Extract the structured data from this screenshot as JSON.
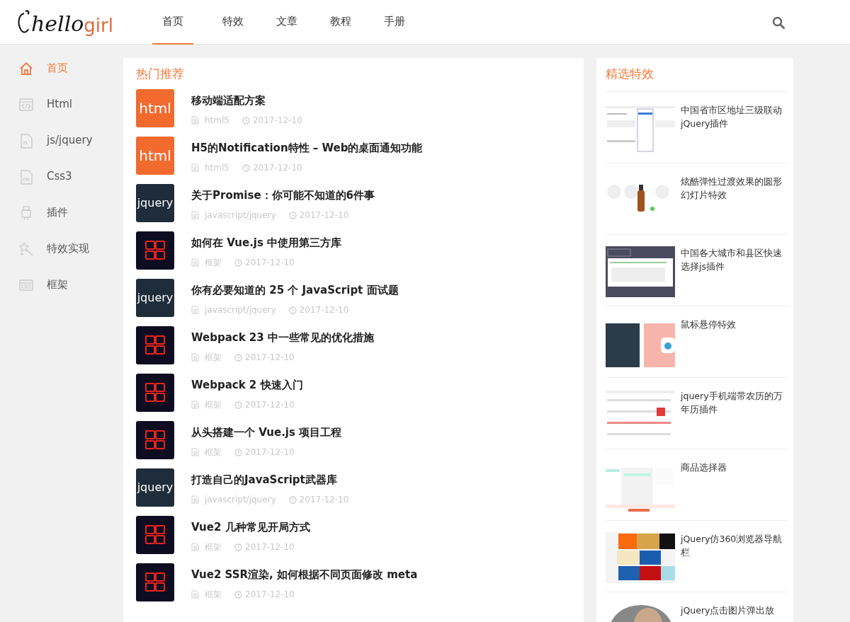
{
  "logo": {
    "main": "hello",
    "accent": "girl"
  },
  "nav": [
    {
      "label": "首页",
      "selected": true
    },
    {
      "label": "特效",
      "selected": false
    },
    {
      "label": "文章",
      "selected": false
    },
    {
      "label": "教程",
      "selected": false
    },
    {
      "label": "手册",
      "selected": false
    }
  ],
  "sidebar": {
    "items": [
      {
        "label": "首页",
        "selected": true
      },
      {
        "label": "Html",
        "selected": false
      },
      {
        "label": "js/jquery",
        "selected": false
      },
      {
        "label": "Css3",
        "selected": false
      },
      {
        "label": "插件",
        "selected": false
      },
      {
        "label": "特效实现",
        "selected": false
      },
      {
        "label": "框架",
        "selected": false
      }
    ]
  },
  "hot": {
    "title": "热门推荐",
    "articles": [
      {
        "kind": "html",
        "thumb": "html",
        "title": "移动端适配方案",
        "category": "html5",
        "date": "2017-12-10"
      },
      {
        "kind": "html",
        "thumb": "html",
        "title": "H5的Notification特性 – Web的桌面通知功能",
        "category": "html5",
        "date": "2017-12-10"
      },
      {
        "kind": "jquery",
        "thumb": "jquery",
        "title": "关于Promise：你可能不知道的6件事",
        "category": "javascript/jquery",
        "date": "2017-12-10"
      },
      {
        "kind": "framework",
        "title": "如何在 Vue.js 中使用第三方库",
        "category": "框架",
        "date": "2017-12-10"
      },
      {
        "kind": "jquery",
        "thumb": "jquery",
        "title": "你有必要知道的 25 个 JavaScript 面试题",
        "category": "javascript/jquery",
        "date": "2017-12-10"
      },
      {
        "kind": "framework",
        "title": "Webpack 23 中一些常见的优化措施",
        "category": "框架",
        "date": "2017-12-10"
      },
      {
        "kind": "framework",
        "title": "Webpack 2 快速入门",
        "category": "框架",
        "date": "2017-12-10"
      },
      {
        "kind": "framework",
        "title": "从头搭建一个 Vue.js 项目工程",
        "category": "框架",
        "date": "2017-12-10"
      },
      {
        "kind": "jquery",
        "thumb": "jquery",
        "title": "打造自己的JavaScript武器库",
        "category": "javascript/jquery",
        "date": "2017-12-10"
      },
      {
        "kind": "framework",
        "title": "Vue2 几种常见开局方式",
        "category": "框架",
        "date": "2017-12-10"
      },
      {
        "kind": "framework",
        "title": "Vue2 SSR渲染, 如何根据不同页面修改 meta",
        "category": "框架",
        "date": "2017-12-10"
      }
    ]
  },
  "effects": {
    "title": "精选特效",
    "items": [
      {
        "title": "中国省市区地址三级联动jQuery插件"
      },
      {
        "title": "炫酷弹性过渡效果的圆形幻灯片特效"
      },
      {
        "title": "中国各大城市和县区快速选择js插件"
      },
      {
        "title": "鼠标悬停特效"
      },
      {
        "title": "jquery手机端带农历的万年历插件"
      },
      {
        "title": "商品选择器"
      },
      {
        "title": "jQuery仿360浏览器导航栏"
      },
      {
        "title": "jQuery点击图片弹出放"
      }
    ]
  }
}
